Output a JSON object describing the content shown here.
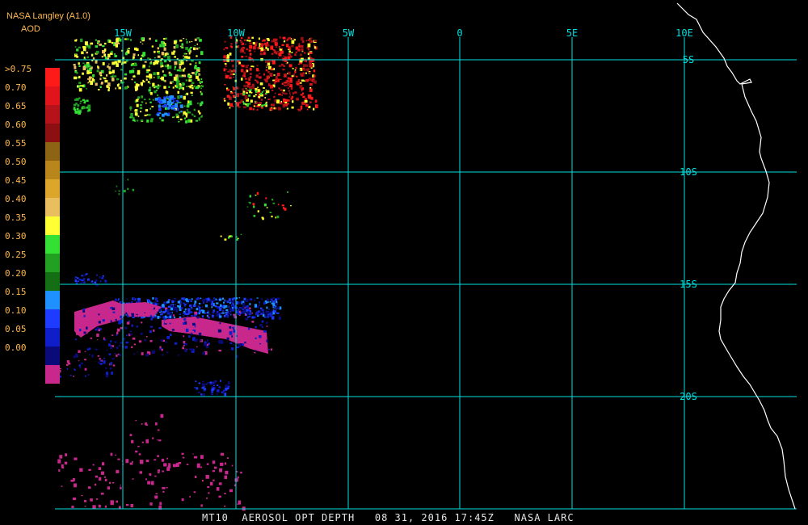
{
  "header": {
    "title": "NASA Langley (A1.0)",
    "unit": "AOD"
  },
  "legend": {
    "labels": [
      ">0.75",
      "0.70",
      "0.65",
      "0.60",
      "0.55",
      "0.50",
      "0.45",
      "0.40",
      "0.35",
      "0.30",
      "0.25",
      "0.20",
      "0.15",
      "0.10",
      "0.05",
      "0.00"
    ],
    "colors": [
      "#ff1a1a",
      "#e0141a",
      "#b51219",
      "#8c0f12",
      "#8c6414",
      "#b8861b",
      "#dba62a",
      "#e8be5e",
      "#ffff33",
      "#33e033",
      "#22a022",
      "#146e14",
      "#1e90ff",
      "#1e3cff",
      "#0f1ec8",
      "#0a0a78",
      "#c8288c"
    ]
  },
  "map": {
    "lon_labels": [
      "15W",
      "10W",
      "5W",
      "0",
      "5E",
      "10E"
    ],
    "lat_labels": [
      "5S",
      "10S",
      "15S",
      "20S"
    ],
    "grid_color": "#00e0e0",
    "coast_color": "#ffffff"
  },
  "footer": {
    "text": "MT10  AEROSOL OPT DEPTH   08 31, 2016 17:45Z   NASA LARC"
  }
}
